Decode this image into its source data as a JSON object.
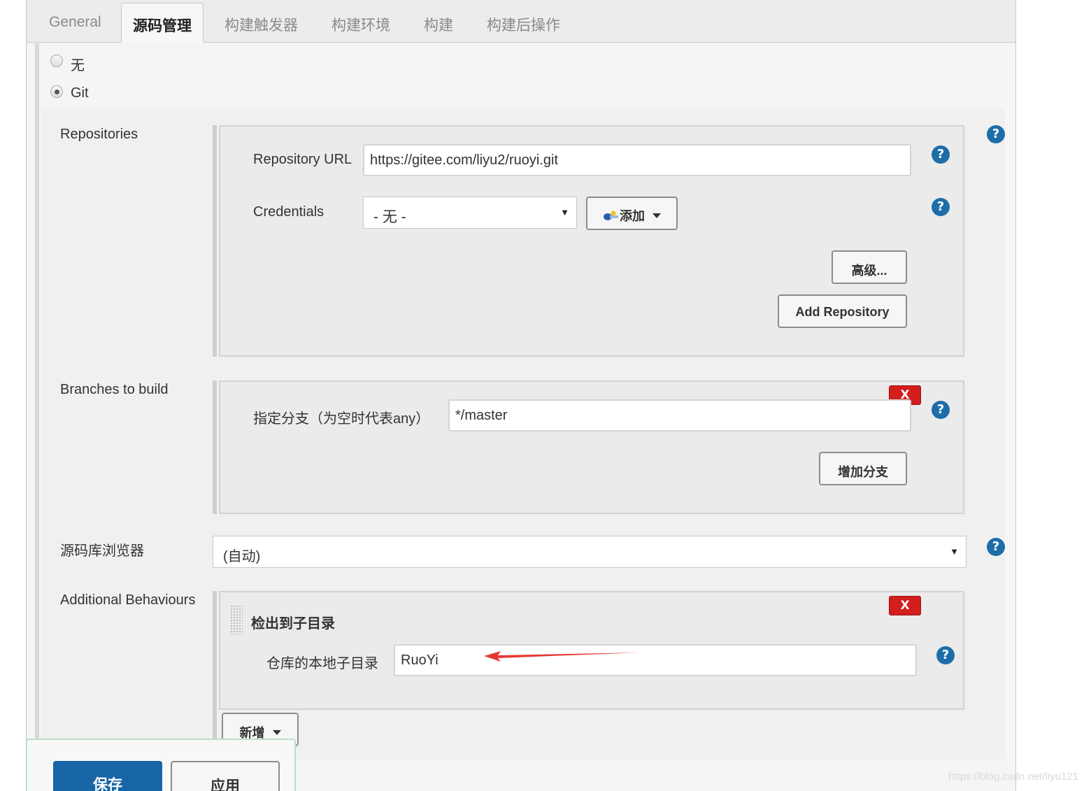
{
  "tabs": [
    "General",
    "源码管理",
    "构建触发器",
    "构建环境",
    "构建",
    "构建后操作"
  ],
  "scm": {
    "options": [
      "无",
      "Git"
    ],
    "selected": "Git"
  },
  "repositories": {
    "label": "Repositories",
    "url_label": "Repository URL",
    "url_value": "https://gitee.com/liyu2/ruoyi.git",
    "credentials_label": "Credentials",
    "credentials_value": "- 无 -",
    "add_button": "添加",
    "advanced_button": "高级...",
    "add_repository_button": "Add Repository"
  },
  "branches": {
    "label": "Branches to build",
    "branch_label": "指定分支（为空时代表any）",
    "branch_value": "*/master",
    "add_branch_button": "增加分支",
    "delete_label": "X"
  },
  "browser": {
    "label": "源码库浏览器",
    "value": "(自动)"
  },
  "behaviours": {
    "label": "Additional Behaviours",
    "item_title": "检出到子目录",
    "subdir_label": "仓库的本地子目录",
    "subdir_value": "RuoYi",
    "delete_label": "X",
    "add_button": "新增"
  },
  "footer": {
    "save_button": "保存",
    "apply_button": "应用"
  },
  "help_symbol": "?",
  "watermark": "https://blog.csdn.net/liyu121",
  "colors": {
    "primary": "#1765a6",
    "help": "#1d6ea8",
    "delete": "#d41d1d",
    "annotation_arrow": "#e53935"
  }
}
